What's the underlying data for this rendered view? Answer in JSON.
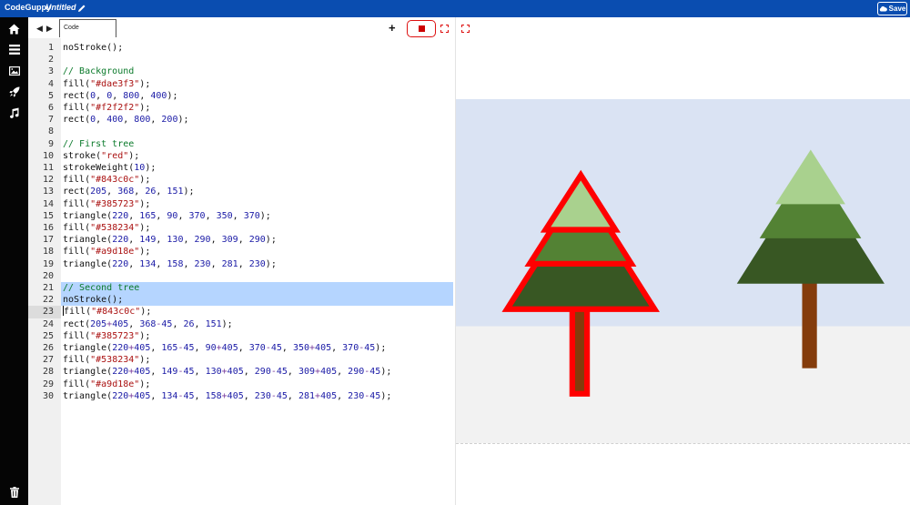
{
  "app": {
    "name": "CodeGuppy",
    "document_title": "Untitled",
    "save_label": "Save"
  },
  "sidebar": {
    "items": [
      {
        "icon": "home-icon"
      },
      {
        "icon": "menu-icon"
      },
      {
        "icon": "image-icon"
      },
      {
        "icon": "rocket-icon"
      },
      {
        "icon": "music-icon"
      }
    ],
    "bottom_icon": "trash-icon"
  },
  "editor": {
    "tab_label": "Code",
    "add_symbol": "+",
    "current_line": 23,
    "selected_lines": [
      21,
      22
    ],
    "lines": [
      "noStroke();",
      "",
      "// Background",
      "fill(\"#dae3f3\");",
      "rect(0, 0, 800, 400);",
      "fill(\"#f2f2f2\");",
      "rect(0, 400, 800, 200);",
      "",
      "// First tree",
      "stroke(\"red\");",
      "strokeWeight(10);",
      "fill(\"#843c0c\");",
      "rect(205, 368, 26, 151);",
      "fill(\"#385723\");",
      "triangle(220, 165, 90, 370, 350, 370);",
      "fill(\"#538234\");",
      "triangle(220, 149, 130, 290, 309, 290);",
      "fill(\"#a9d18e\");",
      "triangle(220, 134, 158, 230, 281, 230);",
      "",
      "// Second tree",
      "noStroke();",
      "fill(\"#843c0c\");",
      "rect(205+405, 368-45, 26, 151);",
      "fill(\"#385723\");",
      "triangle(220+405, 165-45, 90+405, 370-45, 350+405, 370-45);",
      "fill(\"#538234\");",
      "triangle(220+405, 149-45, 130+405, 290-45, 309+405, 290-45);",
      "fill(\"#a9d18e\");",
      "triangle(220+405, 134-45, 158+405, 230-45, 281+405, 230-45);"
    ]
  },
  "colors": {
    "topbar": "#0a4db0",
    "sky": "#dae3f3",
    "ground": "#f2f2f2",
    "trunk": "#843c0c",
    "dark_green": "#385723",
    "mid_green": "#538234",
    "light_green": "#a9d18e",
    "outline": "red"
  }
}
